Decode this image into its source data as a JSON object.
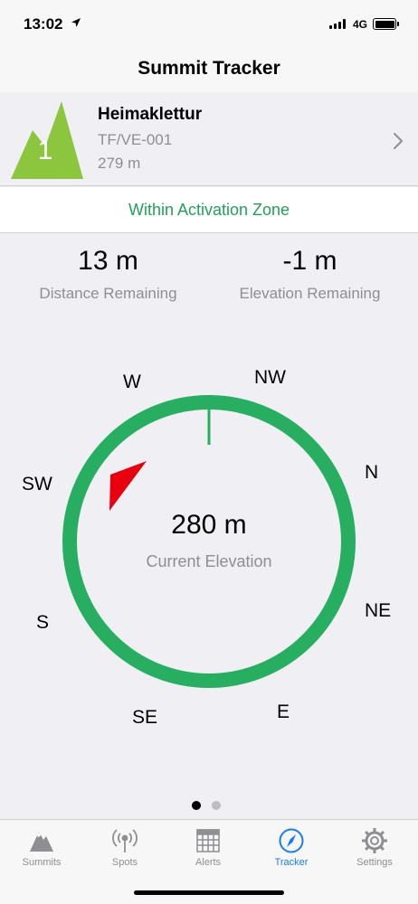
{
  "status": {
    "time": "13:02",
    "network": "4G"
  },
  "nav": {
    "title": "Summit Tracker"
  },
  "summit": {
    "points": "1",
    "name": "Heimaklettur",
    "reference": "TF/VE-001",
    "altitude": "279 m"
  },
  "zone": {
    "text": "Within Activation Zone"
  },
  "stats": {
    "distance_value": "13 m",
    "distance_label": "Distance Remaining",
    "elevation_value": "-1 m",
    "elevation_label": "Elevation Remaining"
  },
  "compass": {
    "directions": {
      "w": "W",
      "nw": "NW",
      "sw": "SW",
      "n": "N",
      "s": "S",
      "ne": "NE",
      "se": "SE",
      "e": "E"
    },
    "elevation_value": "280 m",
    "elevation_label": "Current Elevation",
    "ring_color": "#27ae60",
    "pointer_color": "#e8000f"
  },
  "pager": {
    "pages": 2,
    "current": 1
  },
  "tabs": [
    {
      "label": "Summits",
      "icon": "mountain-icon"
    },
    {
      "label": "Spots",
      "icon": "antenna-icon"
    },
    {
      "label": "Alerts",
      "icon": "calendar-icon"
    },
    {
      "label": "Tracker",
      "icon": "compass-icon",
      "active": true
    },
    {
      "label": "Settings",
      "icon": "gear-icon"
    }
  ]
}
